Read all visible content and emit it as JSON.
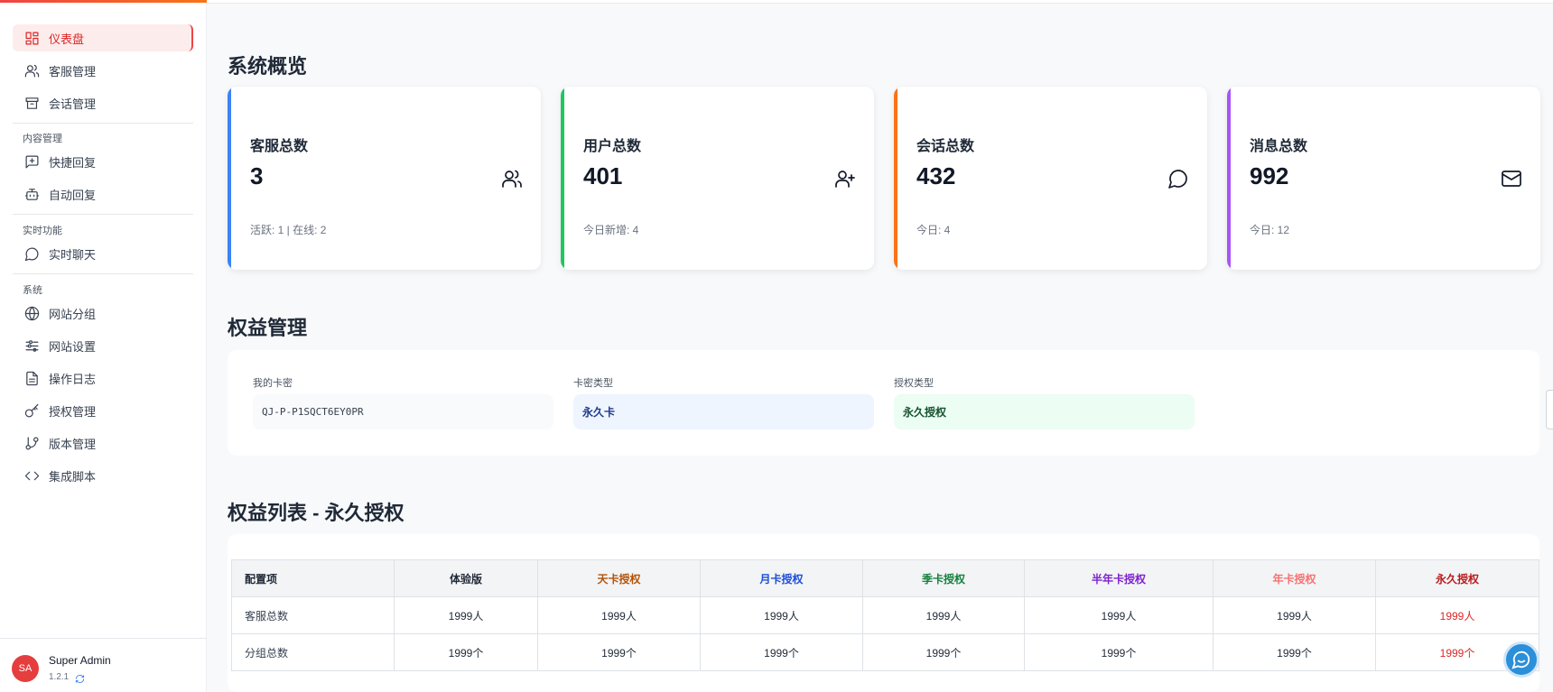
{
  "sidebar": {
    "items": [
      {
        "label": "仪表盘",
        "icon": "dashboard-icon"
      },
      {
        "label": "客服管理",
        "icon": "users-icon"
      },
      {
        "label": "会话管理",
        "icon": "archive-icon"
      },
      {
        "label": "快捷回复",
        "icon": "message-plus-icon"
      },
      {
        "label": "自动回复",
        "icon": "bot-icon"
      },
      {
        "label": "实时聊天",
        "icon": "chat-icon"
      },
      {
        "label": "网站分组",
        "icon": "globe-icon"
      },
      {
        "label": "网站设置",
        "icon": "sliders-icon"
      },
      {
        "label": "操作日志",
        "icon": "file-text-icon"
      },
      {
        "label": "授权管理",
        "icon": "key-icon"
      },
      {
        "label": "版本管理",
        "icon": "git-branch-icon"
      },
      {
        "label": "集成脚本",
        "icon": "code-icon"
      }
    ],
    "sections": {
      "content": "内容管理",
      "realtime": "实时功能",
      "system": "系统"
    },
    "user": {
      "initials": "SA",
      "name": "Super Admin",
      "version": "1.2.1"
    }
  },
  "overview": {
    "title": "系统概览",
    "cards": [
      {
        "label": "客服总数",
        "value": "3",
        "sub": "活跃: 1 | 在线: 2",
        "color": "#3b82f6",
        "icon": "users-icon"
      },
      {
        "label": "用户总数",
        "value": "401",
        "sub": "今日新增: 4",
        "color": "#22c55e",
        "icon": "user-plus-icon"
      },
      {
        "label": "会话总数",
        "value": "432",
        "sub": "今日: 4",
        "color": "#f97316",
        "icon": "chat-icon"
      },
      {
        "label": "消息总数",
        "value": "992",
        "sub": "今日: 12",
        "color": "#a855f7",
        "icon": "mail-icon"
      }
    ]
  },
  "rights": {
    "title": "权益管理",
    "key_label": "我的卡密",
    "key_value": "QJ-P-P1SQCT6EY0PR",
    "card_type_label": "卡密类型",
    "card_type_value": "永久卡",
    "auth_type_label": "授权类型",
    "auth_type_value": "永久授权"
  },
  "table": {
    "title": "权益列表 - 永久授权",
    "headers": [
      {
        "label": "配置项",
        "color": "#1f2937"
      },
      {
        "label": "体验版",
        "color": "#1f2937"
      },
      {
        "label": "天卡授权",
        "color": "#b45309"
      },
      {
        "label": "月卡授权",
        "color": "#1d4ed8"
      },
      {
        "label": "季卡授权",
        "color": "#15803d"
      },
      {
        "label": "半年卡授权",
        "color": "#7e22ce"
      },
      {
        "label": "年卡授权",
        "color": "#f87171"
      },
      {
        "label": "永久授权",
        "color": "#b91c1c"
      }
    ],
    "rows": [
      [
        "客服总数",
        "1999人",
        "1999人",
        "1999人",
        "1999人",
        "1999人",
        "1999人",
        "1999人"
      ],
      [
        "分组总数",
        "1999个",
        "1999个",
        "1999个",
        "1999个",
        "1999个",
        "1999个",
        "1999个"
      ]
    ]
  }
}
